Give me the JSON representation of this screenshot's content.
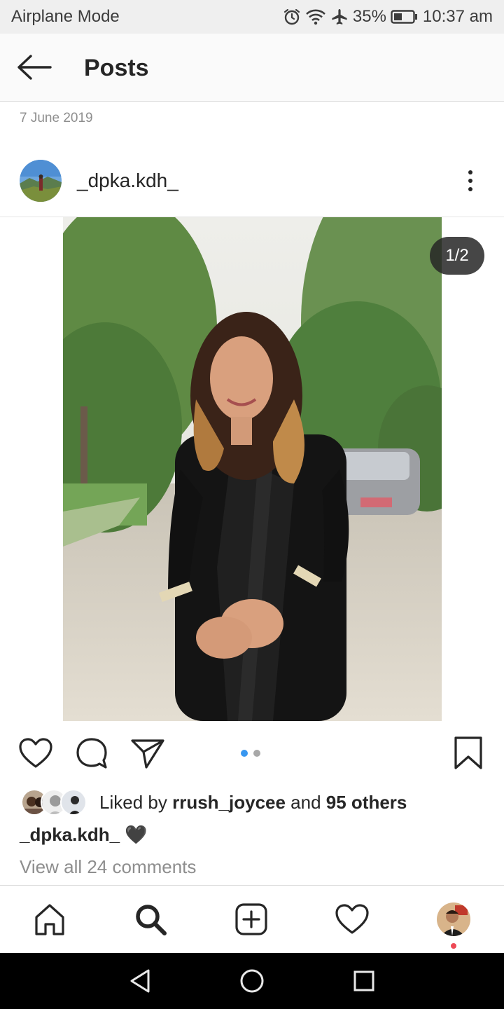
{
  "status_bar": {
    "left_text": "Airplane Mode",
    "battery": "35%",
    "time": "10:37 am",
    "icons": [
      "alarm-icon",
      "wifi-icon",
      "airplane-icon",
      "battery-icon"
    ]
  },
  "header": {
    "back_icon": "arrow-left-icon",
    "title": "Posts"
  },
  "post": {
    "date": "7 June 2019",
    "username": "_dpka.kdh_",
    "more_icon": "more-vertical-icon",
    "photo_counter": "1/2",
    "carousel": {
      "total": 2,
      "current": 1,
      "active_color": "#3897f0",
      "inactive_color": "#a8a8a8"
    },
    "actions": [
      "like-icon",
      "comment-icon",
      "share-icon",
      "bookmark-icon"
    ],
    "likes": {
      "prefix": "Liked by ",
      "first_liker": "rrush_joycee",
      "middle": " and ",
      "others": "95 others"
    },
    "caption": {
      "username": "_dpka.kdh_",
      "text": " 🖤"
    },
    "view_comments": "View all 24 comments"
  },
  "bottom_nav": {
    "items": [
      "home-icon",
      "search-icon",
      "add-post-icon",
      "activity-heart-icon",
      "profile-avatar"
    ],
    "notification_color": "#ed4956"
  },
  "system_nav": [
    "back-triangle-icon",
    "home-circle-icon",
    "recents-square-icon"
  ]
}
